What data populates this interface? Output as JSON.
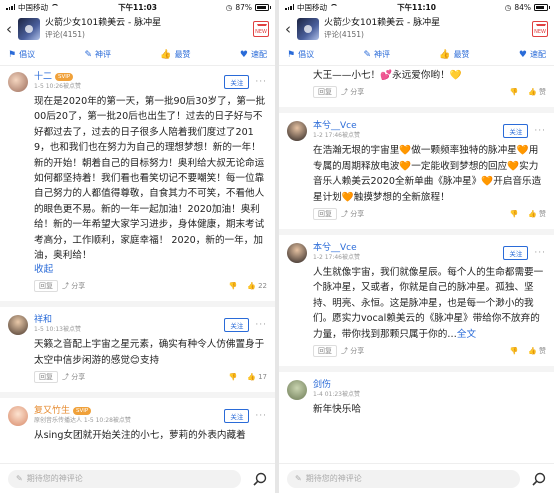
{
  "phones": [
    {
      "status": {
        "carrier": "中国移动",
        "time": "下午11:03",
        "battery": "87%",
        "battery_level": 0.87
      },
      "header": {
        "title": "火箭少女101赖美云 - 脉冲星",
        "subtitle": "评论(4151)",
        "badge": "NEW"
      },
      "tabs": {
        "items": [
          "倡议",
          "神评",
          "最赞",
          "速配"
        ]
      },
      "comments": [
        {
          "user": "十二",
          "vip": "SVIP",
          "meta": "1-5 10:26被点赞",
          "follow": "关注",
          "text": "现在是2020年的第一天，第一批90后30岁了，第一批00后20了，第一批20后也出生了！过去的日子好与不好都过去了，过去的日子很多人陪着我们度过了2019，也和我们也在努力为自己的理想梦想！新的一年！新的开始！朝着自己的目标努力！奥利给大叔无论命运如何都坚持着！我们看也看笑切记不要嘲笑！每一位靠自己努力的人都值得尊敬，自食其力不可笑，不看他人的眼色更不易。新的一年一起加油！2020加油！奥利给！新的一年希望大家学习进步，身体健康，期末考试考高分，工作顺利，家庭幸福！ 2020，新的一年，加油，奥利给！",
          "collapse": "收起",
          "reply": "回复",
          "share": "分享",
          "likes": "22"
        },
        {
          "user": "祥和",
          "meta": "1-5 10:13被点赞",
          "follow": "关注",
          "text": "天籁之音配上宇宙之星元素，确实有种令人仿佛置身于太空中信步闲游的感觉😊支持",
          "reply": "回复",
          "share": "分享",
          "likes": "17"
        },
        {
          "user": "复又竹生",
          "vip": "SVIP",
          "meta": "原创音乐传播达人 1-5 10:28被点赞",
          "follow": "关注",
          "text": "从sing女团就开始关注的小七，萝莉的外表内藏着"
        }
      ],
      "composer": {
        "placeholder": "期待您的神评论"
      }
    },
    {
      "status": {
        "carrier": "中国移动",
        "time": "下午11:10",
        "battery": "84%",
        "battery_level": 0.84
      },
      "header": {
        "title": "火箭少女101赖美云 - 脉冲星",
        "subtitle": "评论(4151)",
        "badge": "NEW"
      },
      "tabs": {
        "items": [
          "倡议",
          "神评",
          "最赞",
          "速配"
        ]
      },
      "comments": [
        {
          "user": "",
          "meta": "",
          "text": "大王——小七！💕永远爱你哟！💛",
          "reply": "回复",
          "share": "分享",
          "likes": "赞"
        },
        {
          "user": "本兮__Vce",
          "meta": "1-2 17:46被点赞",
          "follow": "关注",
          "text": "在浩瀚无垠的宇宙里🧡做一颗频率独特的脉冲星🧡用专属的周期释放电波🧡一定能收到梦想的回应🧡实力音乐人赖美云2020全新单曲《脉冲星》🧡开启音乐造星计划🧡触摸梦想的全新旅程！",
          "reply": "回复",
          "share": "分享",
          "likes": "赞"
        },
        {
          "user": "本兮__Vce",
          "meta": "1-2 17:46被点赞",
          "follow": "关注",
          "text": "人生就像宇宙，我们就像星辰。每个人的生命都需要一个脉冲星，又或者，你就是自己的脉冲星。孤独、坚持、明亮、永恒。这是脉冲星，也是每一个渺小的我们。愿实力vocal赖美云的《脉冲星》带给你不放弃的力量，带你找到那颗只属于你的…",
          "full_text_link": "全文",
          "reply": "回复",
          "share": "分享",
          "likes": "赞"
        },
        {
          "user": "剑伤",
          "meta": "1-4 01:23被点赞",
          "text": "新年快乐哈"
        }
      ],
      "composer": {
        "placeholder": "期待您的神评论"
      }
    }
  ]
}
